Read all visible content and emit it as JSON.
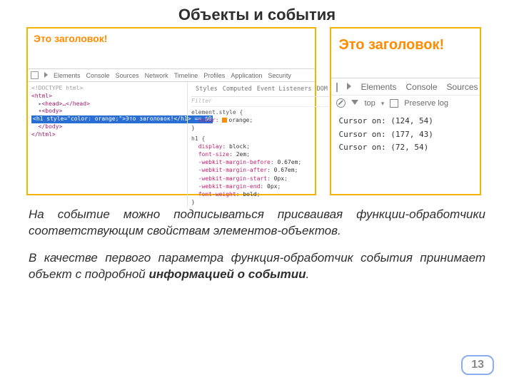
{
  "title": "Объекты и события",
  "page_number": "13",
  "left": {
    "page_heading": "Это заголовок!",
    "tabs": [
      "Elements",
      "Console",
      "Sources",
      "Network",
      "Timeline",
      "Profiles",
      "Application",
      "Security"
    ],
    "subtabs": [
      "Styles",
      "Computed",
      "Event Listeners",
      "DOM B"
    ],
    "filter_placeholder": "Filter",
    "dom_lines": {
      "doctype": "<!DOCTYPE html>",
      "html_open": "<html>",
      "head": "<head>…</head>",
      "body_open": "<body>",
      "h1_sel": "<h1 style=\"color: orange;\">Это заголовок!</h1> == $0",
      "body_close": "</body>",
      "html_close": "</html>"
    },
    "styles_block": {
      "rule1_sel": "element.style {",
      "rule1_prop": "color",
      "rule1_val": "orange",
      "rule2_sel": "h1 {",
      "display": "block",
      "font_size": "2em",
      "mb_before": "0.67em",
      "mb_after": "0.67em",
      "mb_start": "0px",
      "mb_end": "0px",
      "fw": "bold"
    }
  },
  "right": {
    "page_heading": "Это заголовок!",
    "tabs": [
      "Elements",
      "Console",
      "Sources"
    ],
    "row2": {
      "top": "top",
      "preserve": "Preserve log"
    },
    "console_lines": [
      "Cursor on: (124, 54)",
      "Cursor on: (177, 43)",
      "Cursor on: (72, 54)"
    ]
  },
  "para1": "На событие можно подписываться присваивая функции-обработчики соответствующим свойствам элементов-объектов.",
  "para2a": "В качестве первого параметра функция-обработчик события принимает объект с подробной ",
  "para2b": "информацией о событии",
  "para2c": "."
}
